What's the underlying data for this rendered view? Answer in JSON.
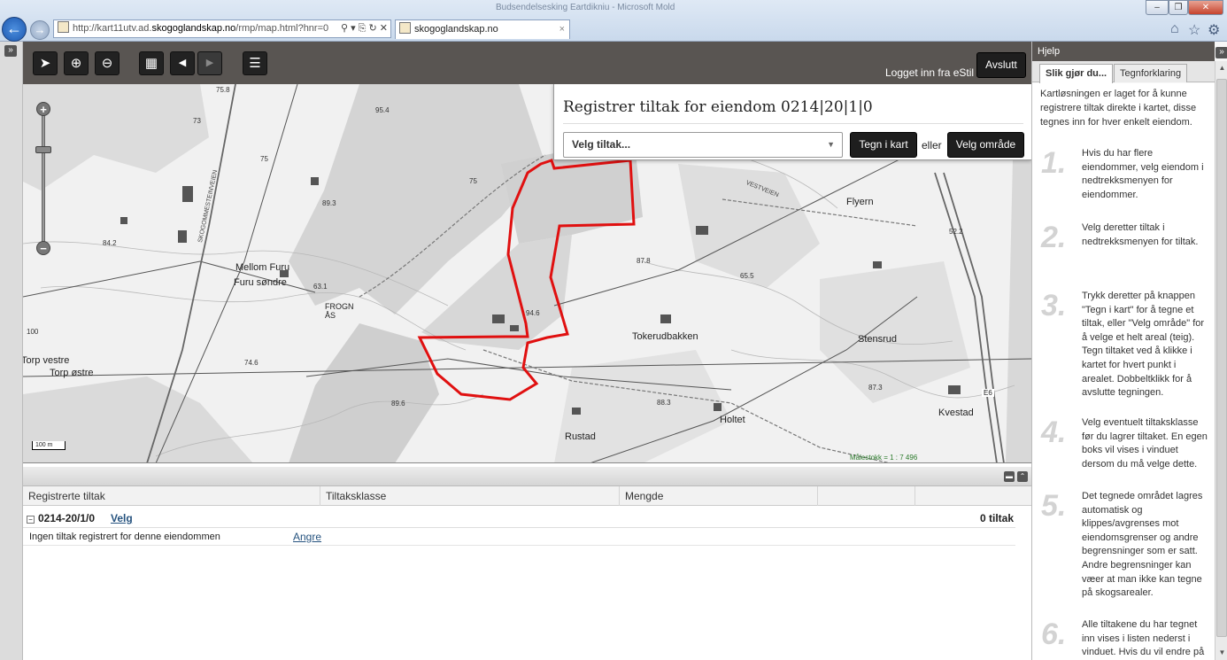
{
  "browser": {
    "window_title": "Budsendelsesking Eartdikniu - Microsoft Mold",
    "address_prefix": "http://kart11utv.ad.",
    "address_domain": "skogoglandskap.no",
    "address_suffix": "/rmp/map.html?hnr=0",
    "address_controls": "⚲ ▾ ⎘ ↻ ✕",
    "tab_label": "skogoglandskap.no",
    "tab_close": "×"
  },
  "toolbar": {
    "logged_in": "Logget inn fra eStil",
    "logout_label": "Avslutt"
  },
  "register_panel": {
    "title": "Registrer tiltak for eiendom 0214|20|1|0",
    "select_value": "Velg tiltak...",
    "draw_label": "Tegn i kart",
    "or_label": "eller",
    "area_label": "Velg område"
  },
  "map": {
    "labels": [
      "Mellom Furu",
      "Furu søndre",
      "FROGN",
      "ÅS",
      "Flyern",
      "Tokerudbakken",
      "Stensrud",
      "Holtet",
      "Rustad",
      "Kvestad",
      "Torp vestre",
      "Torp østre",
      "E6"
    ],
    "road_labels": [
      "SKOGOMMESTEINVEIEN",
      "VESTVEIEN"
    ],
    "heights": [
      "75.8",
      "73",
      "95.4",
      "75",
      "89.3",
      "84.2",
      "63.1",
      "75",
      "74.6",
      "89.6",
      "100",
      "87.8",
      "65.5",
      "52.2",
      "87.3",
      "88.3",
      "94.6"
    ],
    "scale_bar": "100 m",
    "scale_text": "Målestokk = 1 : 7 496",
    "boundary_color": "#e01010"
  },
  "table": {
    "columns": [
      "Registrerte tiltak",
      "Tiltaksklasse",
      "Mengde"
    ],
    "group_name": "0214-20/1/0",
    "group_link": "Velg",
    "group_count": "0 tiltak",
    "empty_text": "Ingen tiltak registrert for denne eiendommen",
    "undo_link": "Angre"
  },
  "help": {
    "title": "Hjelp",
    "tabs": [
      "Slik gjør du...",
      "Tegnforklaring"
    ],
    "intro": "Kartløsningen er laget for å kunne registrere tiltak direkte i kartet, disse tegnes inn for hver enkelt eiendom.",
    "steps": [
      {
        "num": "1.",
        "text": "Hvis du har flere eiendommer, velg eiendom i nedtrekksmenyen for eiendommer."
      },
      {
        "num": "2.",
        "text": "Velg deretter tiltak i nedtrekksmenyen for tiltak."
      },
      {
        "num": "3.",
        "text": "Trykk deretter på knappen \"Tegn i kart\" for å tegne et tiltak, eller \"Velg område\" for å velge et helt areal (teig). Tegn tiltaket ved å klikke i kartet for hvert punkt i arealet. Dobbeltklikk for å avslutte tegningen."
      },
      {
        "num": "4.",
        "text": "Velg eventuelt tiltaksklasse før du lagrer tiltaket. En egen boks vil vises i vinduet dersom du må velge dette."
      },
      {
        "num": "5.",
        "text": "Det tegnede området lagres automatisk og klippes/avgrenses mot eiendomsgrenser og andre begrensninger som er satt. Andre begrensninger kan væer at man ikke kan tegne på skogsarealer."
      },
      {
        "num": "6.",
        "text": "Alle tiltakene du har tegnet inn vises i listen nederst i vinduet. Hvis du vil endre på"
      }
    ]
  }
}
